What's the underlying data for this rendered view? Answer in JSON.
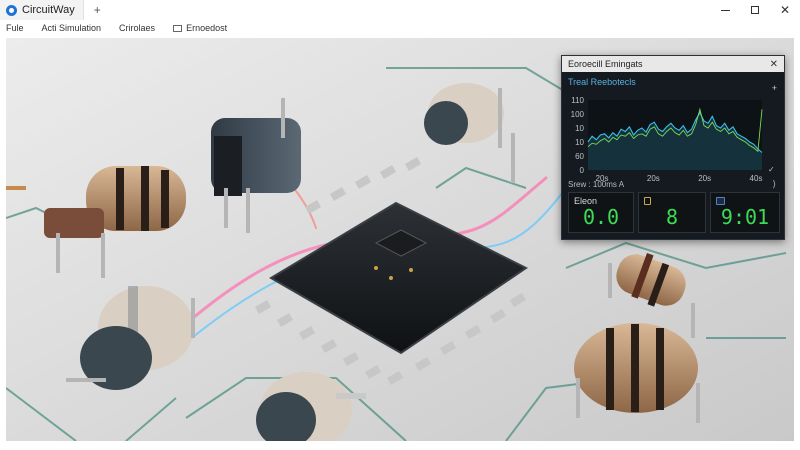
{
  "window": {
    "app_title": "CircuitWay",
    "new_tab_label": "+",
    "minimize_label": "",
    "maximize_label": "",
    "close_label": "✕"
  },
  "menu": {
    "items": [
      {
        "label": "Fule"
      },
      {
        "label": "Acti Simulation"
      },
      {
        "label": "Crirolaes"
      },
      {
        "label": "Ernoedost"
      }
    ]
  },
  "panel": {
    "title": "Eoroecill Emingats",
    "close_label": "✕",
    "status_text": "Srew : 100ms A",
    "status_arrow": "⟩",
    "readouts": [
      {
        "label": "Eleon",
        "value": "0.0"
      },
      {
        "label": "",
        "value": "8"
      },
      {
        "label": "",
        "value": "9:01"
      }
    ]
  },
  "chart_data": {
    "type": "line",
    "title": "Treal Reebotecls",
    "plus_label": "+",
    "x_tick_labels": [
      "20s",
      "20s",
      "20s",
      "40s"
    ],
    "y_tick_labels": [
      "110",
      "100",
      "10",
      "10",
      "60",
      "0"
    ],
    "y_range": [
      0,
      120
    ],
    "series": [
      {
        "color": "#38c0e8",
        "values": [
          48,
          58,
          52,
          60,
          62,
          55,
          64,
          58,
          70,
          66,
          74,
          60,
          68,
          72,
          65,
          78,
          82,
          70,
          66,
          74,
          80,
          72,
          68,
          76,
          64,
          70,
          86,
          98,
          84,
          80,
          92,
          76,
          72,
          80,
          68,
          74,
          62,
          58,
          54,
          48,
          44,
          36,
          30
        ]
      },
      {
        "color": "#7ed957",
        "values": [
          40,
          46,
          44,
          50,
          54,
          48,
          56,
          52,
          60,
          58,
          64,
          54,
          60,
          62,
          58,
          70,
          74,
          62,
          58,
          66,
          72,
          64,
          60,
          68,
          58,
          62,
          78,
          104,
          76,
          72,
          82,
          70,
          66,
          72,
          62,
          66,
          56,
          52,
          48,
          42,
          38,
          32,
          104
        ]
      }
    ],
    "grid": false,
    "legend": "none"
  },
  "colors": {
    "accent_blue": "#1e73d8",
    "readout_green": "#3ddc55",
    "panel_bg": "#141a1f",
    "trace_pink": "#ff6fae",
    "trace_cyan": "#5ec8ff"
  }
}
